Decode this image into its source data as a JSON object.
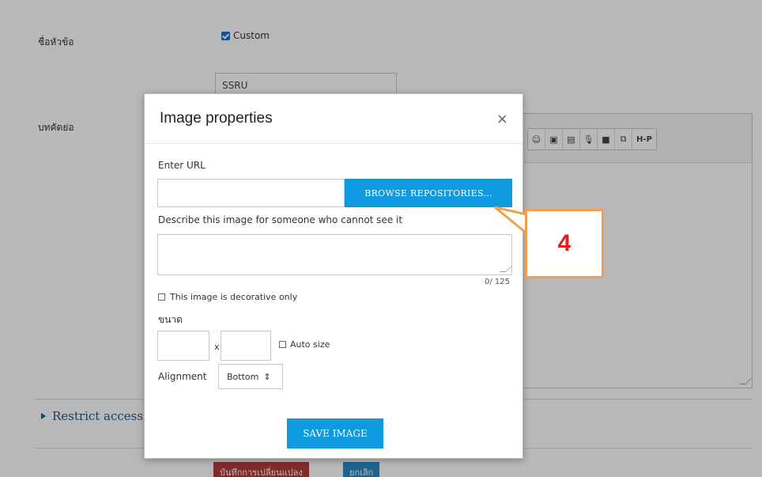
{
  "background": {
    "labels": {
      "subject": "ชื่อหัวข้อ",
      "abstract": "บทคัดย่อ"
    },
    "custom_checkbox_label": "Custom",
    "subject_value": "SSRU",
    "restrict_access": "Restrict access",
    "buttons": {
      "save_changes": "บันทึกการเปลี่ยนแปลง",
      "cancel": "ยกเลิก"
    },
    "editor_toolbar_icons": [
      "emoji-icon",
      "image-icon",
      "media-icon",
      "microphone-icon",
      "video-icon",
      "copy-icon",
      "h5p-icon"
    ],
    "editor_h5p_label": "H-P"
  },
  "modal": {
    "title": "Image properties",
    "close_glyph": "×",
    "enter_url_label": "Enter URL",
    "url_value": "",
    "browse_label": "BROWSE REPOSITORIES...",
    "describe_label": "Describe this image for someone who cannot see it",
    "char_count": "0/ 125",
    "decorative_label": "This image is decorative only",
    "size_label": "ขนาด",
    "size_separator": "x",
    "auto_size_label": "Auto size",
    "alignment_label": "Alignment",
    "alignment_value": "Bottom",
    "save_image_label": "SAVE IMAGE"
  },
  "callout": {
    "number": "4",
    "border_color": "#f0a050",
    "text_color": "#e01f1f"
  },
  "colors": {
    "primary_button": "#0f9ae0",
    "danger_button": "#b33b3b",
    "secondary_button": "#2a88c4"
  }
}
